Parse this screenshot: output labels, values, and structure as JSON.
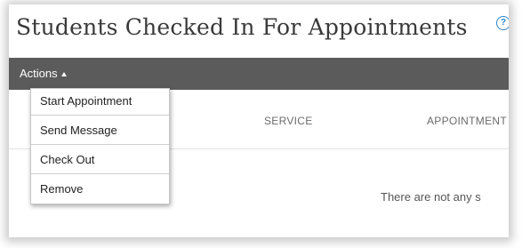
{
  "header": {
    "title": "Students Checked In For Appointments",
    "help_glyph": "?"
  },
  "toolbar": {
    "actions_label": "Actions"
  },
  "actions_menu": {
    "items": [
      {
        "label": "Start Appointment"
      },
      {
        "label": "Send Message"
      },
      {
        "label": "Check Out"
      },
      {
        "label": "Remove"
      }
    ]
  },
  "table": {
    "columns": [
      "SERVICE",
      "APPOINTMENT T"
    ],
    "empty_message": "There are not any s"
  },
  "colors": {
    "toolbar_bg": "#5b5b5b",
    "help_accent": "#2a86c8"
  },
  "icons": {
    "help": "help-circle-icon",
    "actions_caret": "caret-up-icon"
  }
}
